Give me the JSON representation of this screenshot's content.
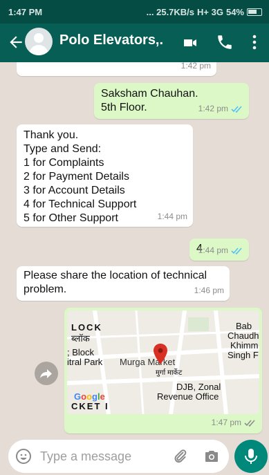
{
  "status_bar": {
    "time": "1:47 PM",
    "network": "... 25.7KB/s",
    "signal": "H+ 3G",
    "battery": "54%"
  },
  "header": {
    "title": "Polo Elevators,."
  },
  "messages": [
    {
      "time": "1:42 pm"
    },
    {
      "text": "Saksham Chauhan.\n5th Floor.",
      "time": "1:42 pm"
    },
    {
      "text": "Thank you.\nType and Send:\n1 for Complaints\n2 for Payment Details\n3 for Account Details\n4 for Technical Support\n5 for Other Support",
      "time": "1:44 pm"
    },
    {
      "text": "4",
      "time": "1:44 pm"
    },
    {
      "text": "Please share the location of technical problem.",
      "time": "1:46 pm"
    },
    {
      "time": "1:47 pm",
      "map": {
        "labels": [
          "LOCK",
          "ब्लॉक",
          "; Block",
          "itral Park",
          "Murga Market",
          "मुर्गा मार्केट",
          "Bab",
          "Chaudh",
          "Khimm",
          "Singh F",
          "DJB, Zonal",
          "Revenue Office",
          "CKET I",
          "Google"
        ]
      }
    }
  ],
  "composer": {
    "placeholder": "Type a message"
  },
  "colors": {
    "header": "#075e54",
    "status": "#054d44",
    "outgoing": "#dcf8c6",
    "accent": "#00897b",
    "ticks": "#4fc3f7"
  },
  "icons": [
    "back-arrow-icon",
    "video-call-icon",
    "phone-icon",
    "more-vert-icon",
    "share-icon",
    "emoji-icon",
    "attach-icon",
    "camera-icon",
    "mic-icon",
    "double-tick-icon",
    "location-pin-icon"
  ]
}
